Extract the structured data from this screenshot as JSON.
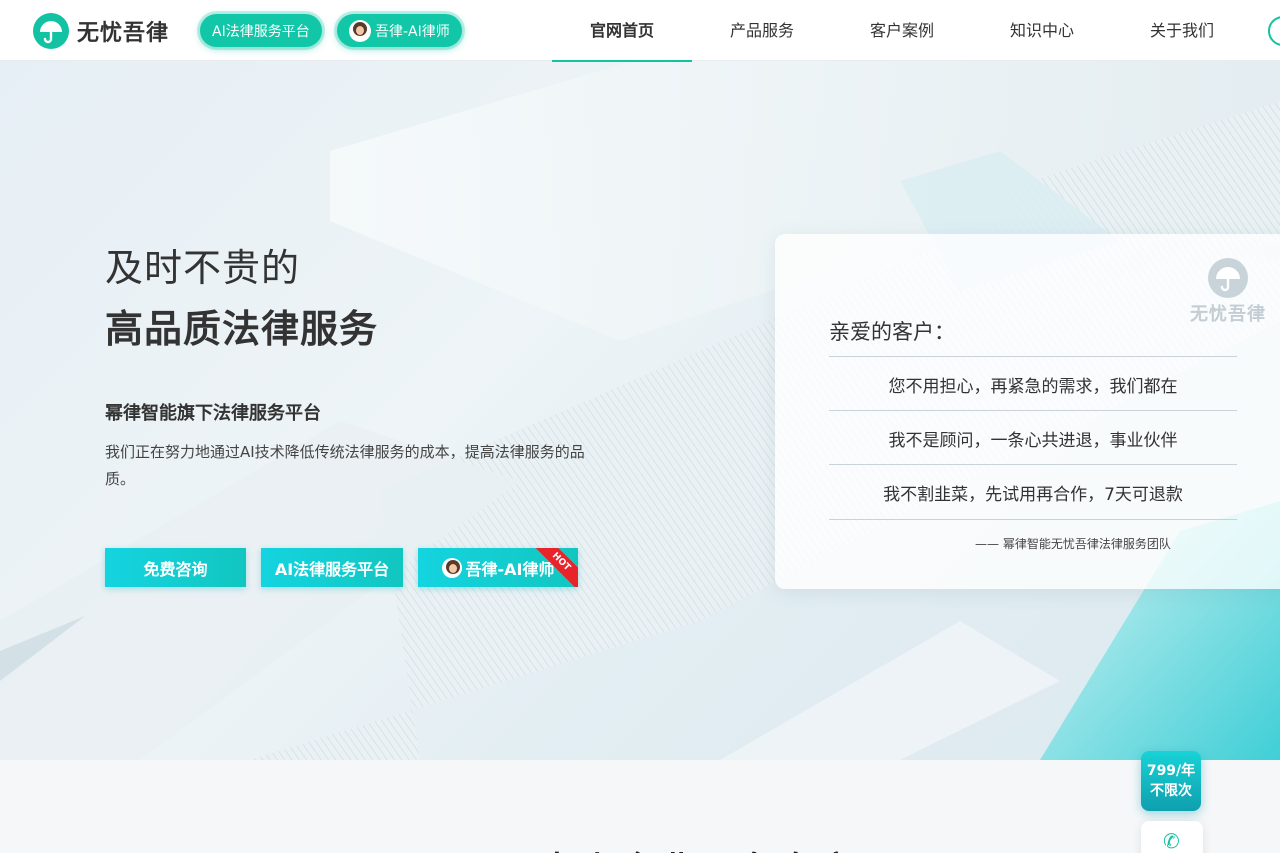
{
  "brand": {
    "name": "无忧吾律"
  },
  "header": {
    "pill_ai_label": "AI法律服务平台",
    "pill_lawyer_label": "吾律-AI律师",
    "nav": [
      {
        "label": "官网首页",
        "active": true
      },
      {
        "label": "产品服务",
        "active": false
      },
      {
        "label": "客户案例",
        "active": false
      },
      {
        "label": "知识中心",
        "active": false
      },
      {
        "label": "关于我们",
        "active": false
      }
    ]
  },
  "hero": {
    "title_line1": "及时不贵的",
    "title_line2": "高品质法律服务",
    "subtitle": "幂律智能旗下法律服务平台",
    "description": "我们正在努力地通过AI技术降低传统法律服务的成本，提高法律服务的品质。",
    "buttons": {
      "consult": "免费咨询",
      "platform": "AI法律服务平台",
      "lawyer": "吾律-AI律师",
      "hot_badge": "HOT"
    }
  },
  "card": {
    "logo_text": "无忧吾律",
    "greeting": "亲爱的客户：",
    "lines": [
      "您不用担心，再紧急的需求，我们都在",
      "我不是顾问，一条心共进退，事业伙伴",
      "我不割韭菜，先试用再合作，7天可退款"
    ],
    "signature": "—— 幂律智能无忧吾律法律服务团队"
  },
  "section": {
    "title": "中小企业服务专家"
  },
  "float": {
    "price_line1": "799/年",
    "price_line2": "不限次"
  },
  "colors": {
    "brand": "#12c2a2",
    "button": "#14d4e0",
    "hot": "#e8232a"
  }
}
